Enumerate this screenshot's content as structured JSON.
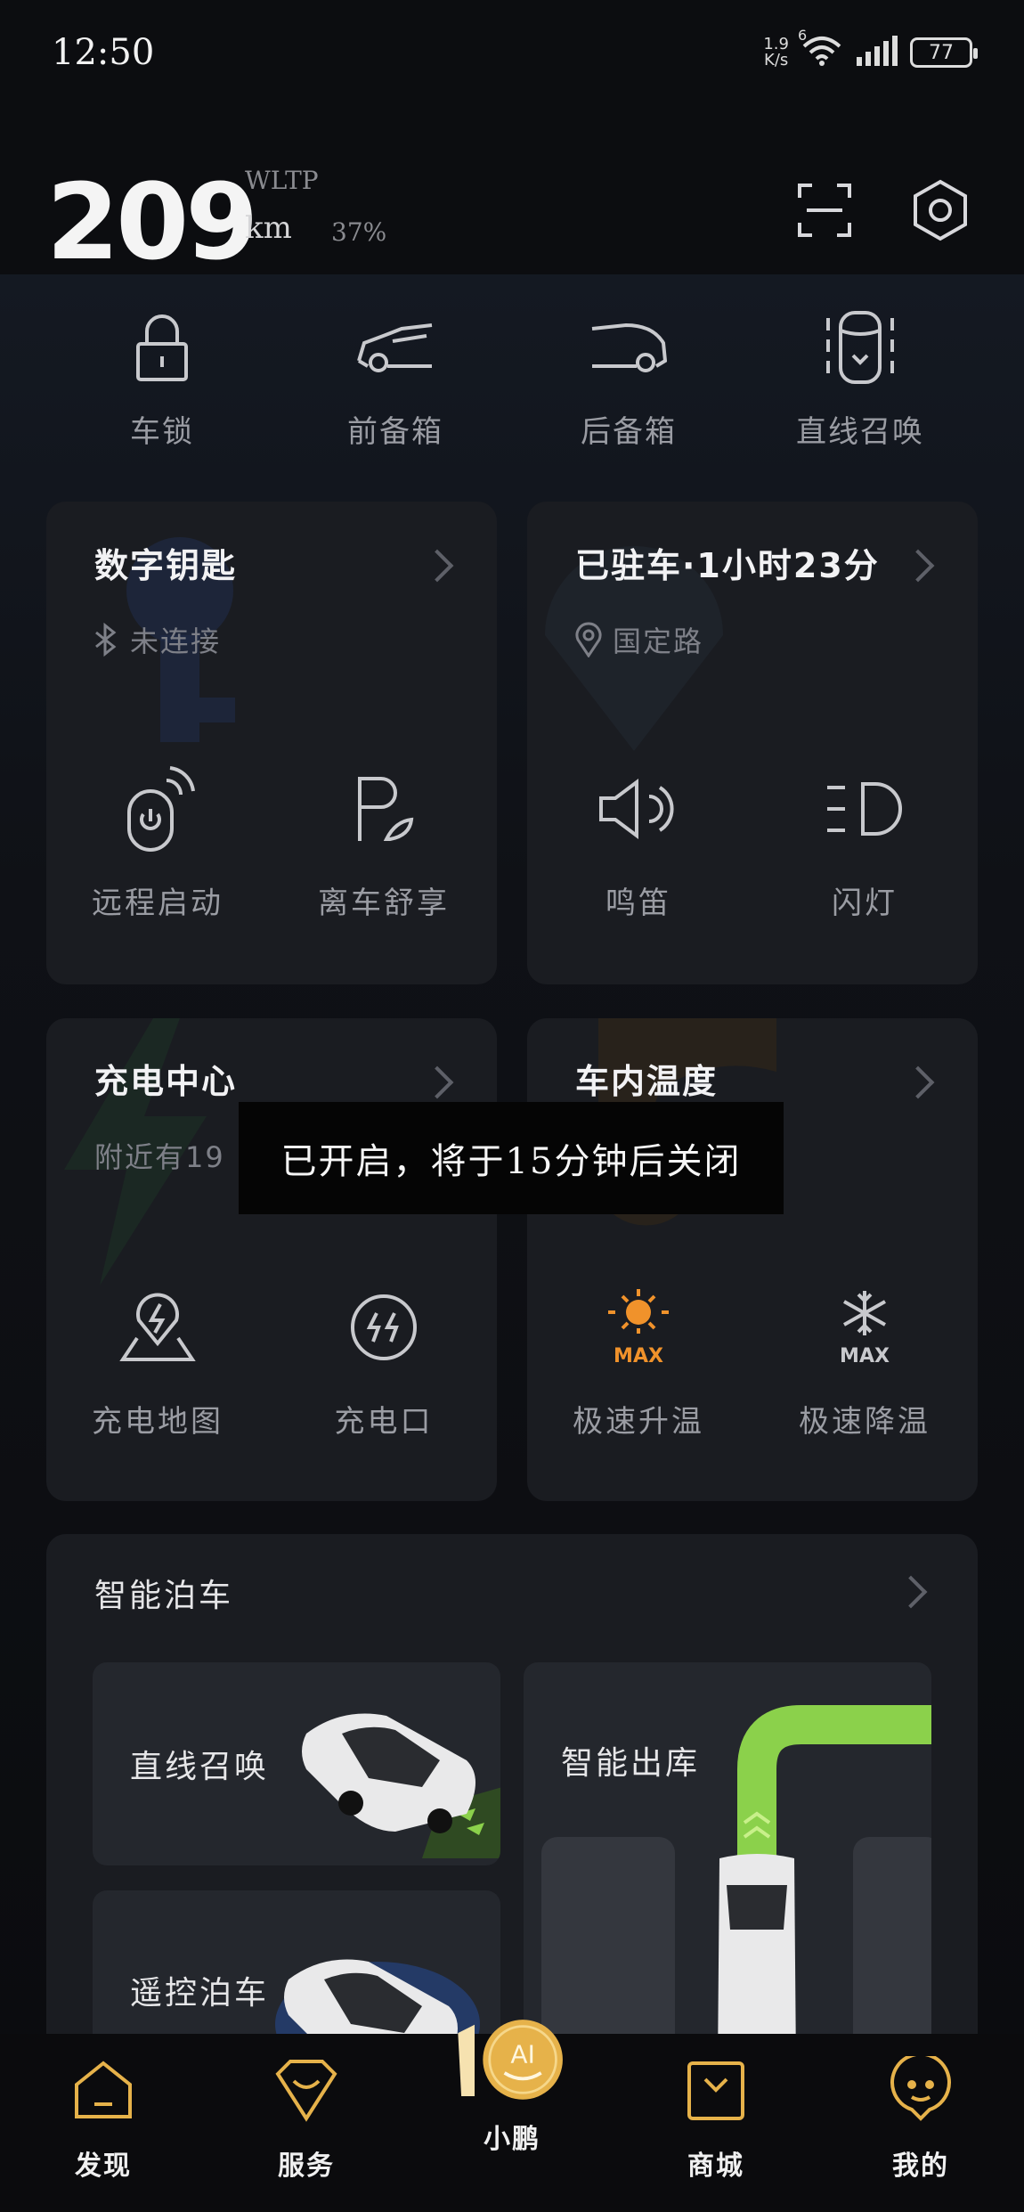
{
  "status_bar": {
    "time": "12:50",
    "speed_value": "1.9",
    "speed_unit": "K/s",
    "network": "6",
    "battery": "77"
  },
  "header": {
    "range_value": "209",
    "range_standard": "WLTP",
    "range_unit": "km",
    "battery_percent": "37%"
  },
  "quick_actions": [
    {
      "label": "车锁",
      "icon": "lock-icon"
    },
    {
      "label": "前备箱",
      "icon": "front-trunk-icon"
    },
    {
      "label": "后备箱",
      "icon": "rear-trunk-icon"
    },
    {
      "label": "直线召唤",
      "icon": "summon-icon"
    }
  ],
  "digital_key_card": {
    "title": "数字钥匙",
    "status": "未连接",
    "actions": [
      {
        "label": "远程启动",
        "icon": "remote-start-icon"
      },
      {
        "label": "离车舒享",
        "icon": "parking-comfort-icon"
      }
    ]
  },
  "parking_card": {
    "title": "已驻车·1小时23分",
    "location": "国定路",
    "actions": [
      {
        "label": "鸣笛",
        "icon": "horn-icon"
      },
      {
        "label": "闪灯",
        "icon": "headlight-icon"
      }
    ]
  },
  "charging_card": {
    "title": "充电中心",
    "subtitle": "附近有19",
    "actions": [
      {
        "label": "充电地图",
        "icon": "charging-map-icon"
      },
      {
        "label": "充电口",
        "icon": "charge-port-icon"
      }
    ]
  },
  "climate_card": {
    "title": "车内温度",
    "actions": [
      {
        "label": "极速升温",
        "icon": "max-heat-icon",
        "badge": "MAX"
      },
      {
        "label": "极速降温",
        "icon": "max-cool-icon",
        "badge": "MAX"
      }
    ]
  },
  "toast": {
    "message": "已开启，将于15分钟后关闭"
  },
  "smart_parking": {
    "title": "智能泊车",
    "tiles": [
      {
        "label": "直线召唤"
      },
      {
        "label": "智能出库"
      },
      {
        "label": "遥控泊车"
      }
    ]
  },
  "bottom_nav": [
    {
      "label": "发现",
      "icon": "discover-icon"
    },
    {
      "label": "服务",
      "icon": "service-icon"
    },
    {
      "label": "小鹏",
      "icon": "xpeng-ai-icon",
      "badge": "AI"
    },
    {
      "label": "商城",
      "icon": "mall-icon"
    },
    {
      "label": "我的",
      "icon": "profile-icon"
    }
  ],
  "colors": {
    "accent_orange": "#f0922b",
    "gold": "#e6b24a",
    "route_green": "#8bd14b"
  }
}
